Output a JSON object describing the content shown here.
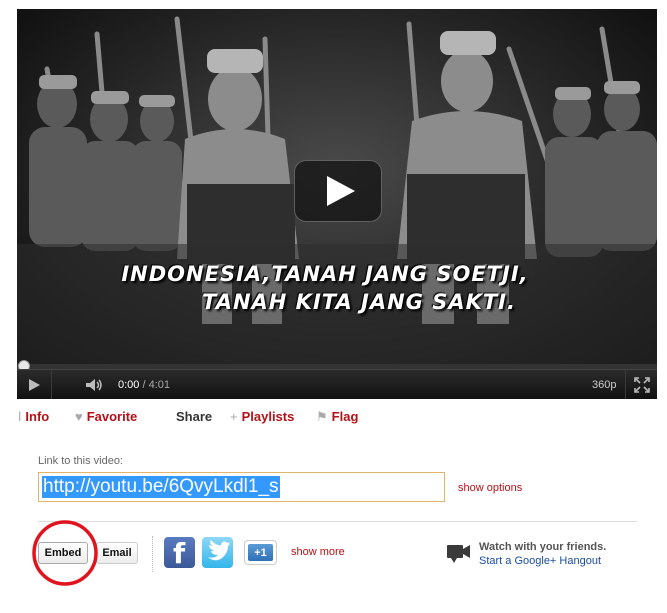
{
  "player": {
    "subtitle_line1": "INDONESIA,TANAH JANG SOETJI,",
    "subtitle_line2": "TANAH KITA JANG SAKTI.",
    "time_current": "0:00",
    "time_duration": "4:01",
    "quality": "360p",
    "progress_fraction": 0,
    "progress_color": "#cc0000",
    "icons": {
      "play": "play-icon",
      "volume": "volume-icon",
      "fullscreen": "fullscreen-icon",
      "big_play": "big-play-icon"
    }
  },
  "actions": {
    "info": "Info",
    "favorite": "Favorite",
    "share": "Share",
    "playlists": "Playlists",
    "flag": "Flag"
  },
  "share": {
    "link_label": "Link to this video:",
    "url": "http://youtu.be/6QvyLkdl1_s",
    "show_options": "show options",
    "embed": "Embed",
    "email": "Email",
    "facebook_letter": "f",
    "gplus_label": "+1",
    "show_more": "show more",
    "hangout_title": "Watch with your friends.",
    "hangout_link": "Start a Google+ Hangout"
  },
  "colors": {
    "link_red": "#b31217",
    "link_blue": "#1a4c9f",
    "selection_blue": "#3399ff",
    "annotation_red": "#e0141e"
  }
}
